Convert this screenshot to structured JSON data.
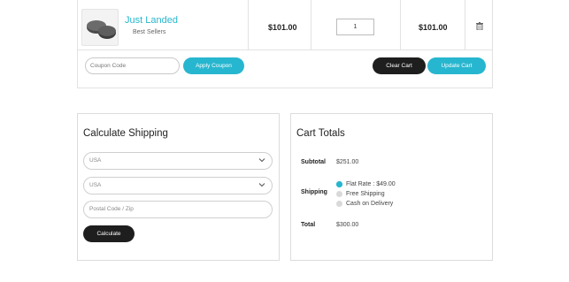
{
  "cart": {
    "item": {
      "name": "Just Landed",
      "category": "Best Sellers",
      "price": "$101.00",
      "quantity": "1",
      "subtotal": "$101.00"
    },
    "coupon_placeholder": "Coupon Code",
    "apply_coupon_label": "Apply Coupon",
    "clear_cart_label": "Clear Cart",
    "update_cart_label": "Update Cart",
    "remove_icon": "trash-icon"
  },
  "shipping": {
    "title": "Calculate Shipping",
    "country_value": "USA",
    "state_value": "USA",
    "postal_placeholder": "Postal Code / Zip",
    "calculate_label": "Calculate"
  },
  "totals": {
    "title": "Cart Totals",
    "subtotal_label": "Subtotal",
    "subtotal_value": "$251.00",
    "shipping_label": "Shipping",
    "shipping_options": [
      {
        "label": "Flat Rate : $49.00",
        "selected": true
      },
      {
        "label": "Free Shipping",
        "selected": false
      },
      {
        "label": "Cash on Delivery",
        "selected": false
      }
    ],
    "total_label": "Total",
    "total_value": "$300.00"
  },
  "colors": {
    "accent": "#27b6cf",
    "dark_button": "#1e1e1e"
  }
}
